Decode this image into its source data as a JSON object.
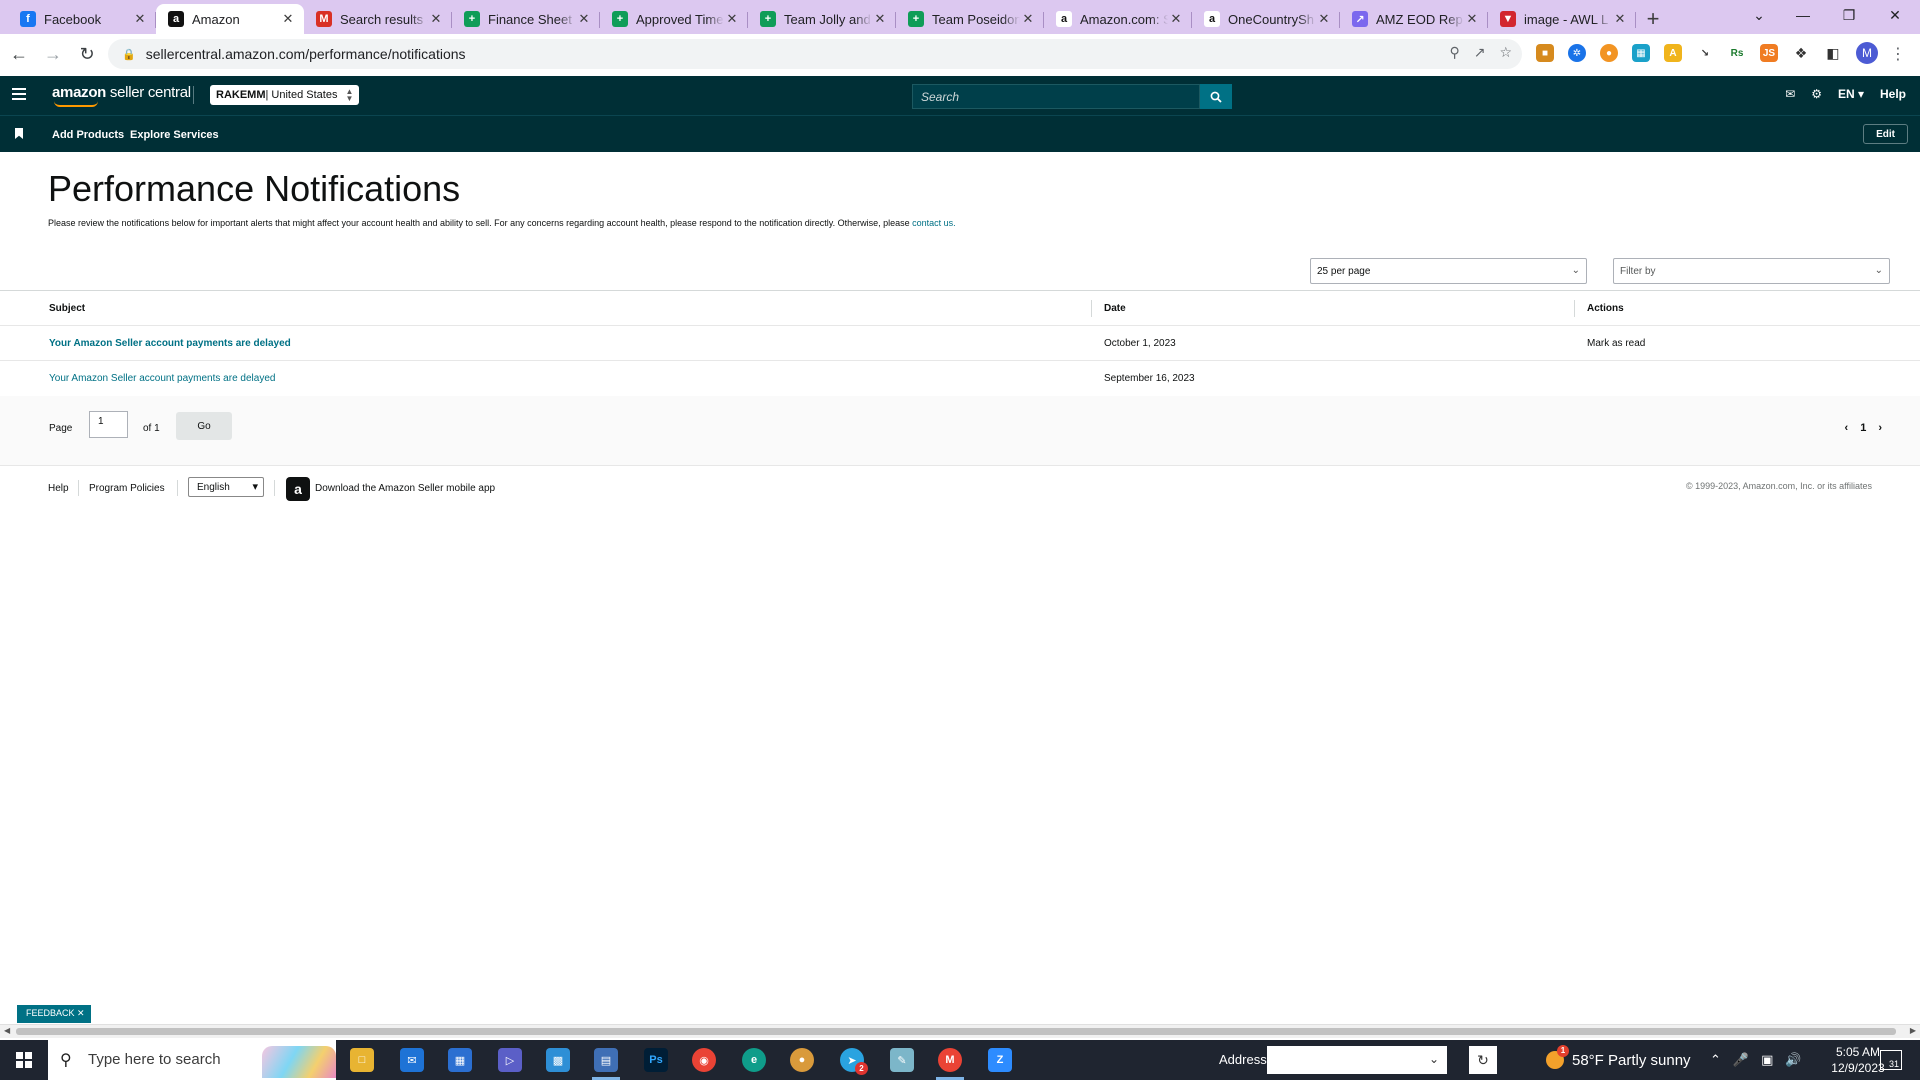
{
  "browser": {
    "tabs": [
      {
        "label": "Facebook",
        "icon": "facebook-icon",
        "color": "#1877f2",
        "glyph": "f"
      },
      {
        "label": "Amazon",
        "icon": "amazon-icon",
        "color": "#111111",
        "glyph": "a",
        "active": true
      },
      {
        "label": "Search results -",
        "icon": "gmail-icon",
        "color": "#d93025",
        "glyph": "M"
      },
      {
        "label": "Finance Sheet -",
        "icon": "sheets-icon",
        "color": "#0f9d58",
        "glyph": "+"
      },
      {
        "label": "Approved Time",
        "icon": "sheets-icon",
        "color": "#0f9d58",
        "glyph": "+"
      },
      {
        "label": "Team Jolly and",
        "icon": "sheets-icon",
        "color": "#0f9d58",
        "glyph": "+"
      },
      {
        "label": "Team Poseidon",
        "icon": "sheets-icon",
        "color": "#0f9d58",
        "glyph": "+"
      },
      {
        "label": "Amazon.com: S",
        "icon": "amazon-icon",
        "color": "#ffffff",
        "glyph": "a"
      },
      {
        "label": "OneCountrySh",
        "icon": "amazon-icon",
        "color": "#ffffff",
        "glyph": "a"
      },
      {
        "label": "AMZ EOD Rep",
        "icon": "clickup-icon",
        "color": "#7b68ee",
        "glyph": "↗"
      },
      {
        "label": "image - AWL L",
        "icon": "vivaldi-icon",
        "color": "#d2262f",
        "glyph": "▼"
      }
    ],
    "url": "sellercentral.amazon.com/performance/notifications",
    "profile_initial": "M"
  },
  "header": {
    "logo_brand": "amazon",
    "logo_product": " seller central",
    "account_name": "RAKEMM",
    "account_region": " | United States",
    "search_placeholder": "Search",
    "language": "EN",
    "help": "Help",
    "nav": {
      "add_products": "Add Products",
      "explore_services": "Explore Services",
      "edit": "Edit"
    }
  },
  "page": {
    "title": "Performance Notifications",
    "intro": "Please review the notifications below for important alerts that might affect your account health and ability to sell. For any concerns regarding account health, please respond to the notification directly. Otherwise, please ",
    "intro_link": "contact us.",
    "per_page": "25 per page",
    "filter_placeholder": "Filter by"
  },
  "table": {
    "columns": {
      "subject": "Subject",
      "date": "Date",
      "actions": "Actions"
    },
    "rows": [
      {
        "subject": "Your Amazon Seller account payments are delayed",
        "date": "October 1, 2023",
        "action": "Mark as read",
        "unread": true
      },
      {
        "subject": "Your Amazon Seller account payments are delayed",
        "date": "September 16, 2023",
        "action": "",
        "unread": false
      }
    ]
  },
  "pagination": {
    "page_label": "Page",
    "current_page": "1",
    "of_label": "of 1",
    "go": "Go",
    "page_number": "1"
  },
  "footer": {
    "help": "Help",
    "program_policies": "Program Policies",
    "language": "English",
    "app_download": "Download the Amazon Seller mobile app",
    "copyright": "© 1999-2023, Amazon.com, Inc. or its affiliates"
  },
  "feedback": "FEEDBACK",
  "taskbar": {
    "search_placeholder": "Type here to search",
    "address_label": "Address",
    "weather": "58°F  Partly sunny",
    "weather_badge": "1",
    "time": "5:05 AM",
    "date": "12/9/2023",
    "notification_count": "31",
    "telegram_badge": "2"
  }
}
